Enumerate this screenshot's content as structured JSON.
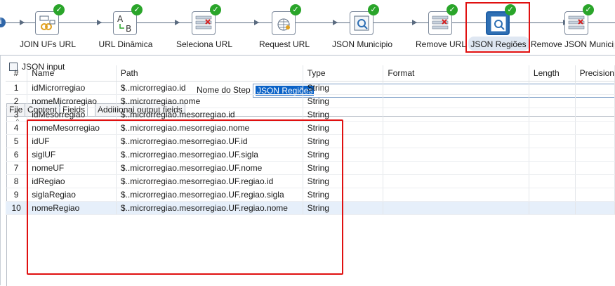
{
  "workflow": {
    "steps": [
      {
        "label": "JOIN UFs URL",
        "icon": "join-icon"
      },
      {
        "label": "URL Dinâmica",
        "icon": "string-replace-icon"
      },
      {
        "label": "Seleciona URL",
        "icon": "select-values-icon"
      },
      {
        "label": "Request URL",
        "icon": "rest-client-icon"
      },
      {
        "label": "JSON Municipio",
        "icon": "json-input-icon"
      },
      {
        "label": "Remove URL",
        "icon": "select-values-icon"
      },
      {
        "label": "JSON Regiões",
        "icon": "json-input-icon",
        "selected": true
      },
      {
        "label": "Remove JSON Municipio",
        "icon": "select-values-icon"
      }
    ],
    "status": "success-check"
  },
  "dialog": {
    "title": "JSON input",
    "step_name_label": "Nome do Step",
    "step_name_value": "JSON Regiões"
  },
  "tabs": [
    "File",
    "Content",
    "Fields",
    "Additional output fields"
  ],
  "active_tab": "Fields",
  "grid": {
    "columns": [
      "#",
      "Name",
      "Path",
      "Type",
      "Format",
      "Length",
      "Precision"
    ],
    "rows": [
      {
        "num": "1",
        "name": "idMicrorregiao",
        "path": "$..microrregiao.id",
        "type": "String"
      },
      {
        "num": "2",
        "name": "nomeMicroregiao",
        "path": "$..microrregiao.nome",
        "type": "String"
      },
      {
        "num": "3",
        "name": "idMesorregiao",
        "path": "$..microrregiao.mesorregiao.id",
        "type": "String"
      },
      {
        "num": "4",
        "name": "nomeMesorregiao",
        "path": "$..microrregiao.mesorregiao.nome",
        "type": "String"
      },
      {
        "num": "5",
        "name": "idUF",
        "path": "$..microrregiao.mesorregiao.UF.id",
        "type": "String"
      },
      {
        "num": "6",
        "name": "siglUF",
        "path": "$..microrregiao.mesorregiao.UF.sigla",
        "type": "String"
      },
      {
        "num": "7",
        "name": "nomeUF",
        "path": "$..microrregiao.mesorregiao.UF.nome",
        "type": "String"
      },
      {
        "num": "8",
        "name": "idRegiao",
        "path": "$..microrregiao.mesorregiao.UF.regiao.id",
        "type": "String"
      },
      {
        "num": "9",
        "name": "siglaRegiao",
        "path": "$..microrregiao.mesorregiao.UF.regiao.sigla",
        "type": "String"
      },
      {
        "num": "10",
        "name": "nomeRegiao",
        "path": "$..microrregiao.mesorregiao.UF.regiao.nome",
        "type": "String"
      }
    ]
  },
  "colors": {
    "highlight": "#e01010",
    "check": "#2aa52a",
    "selection": "#0a62c7"
  }
}
